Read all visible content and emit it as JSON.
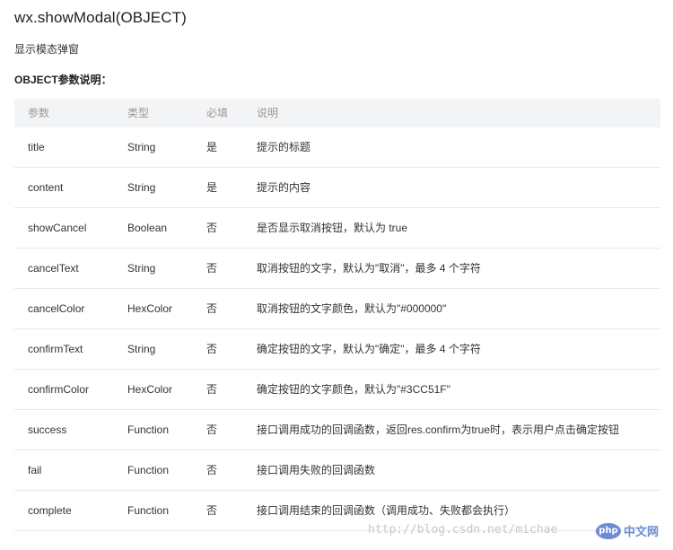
{
  "page": {
    "title": "wx.showModal(OBJECT)",
    "subtitle": "显示模态弹窗",
    "section_title": "OBJECT参数说明："
  },
  "table": {
    "headers": [
      "参数",
      "类型",
      "必填",
      "说明"
    ],
    "rows": [
      [
        "title",
        "String",
        "是",
        "提示的标题"
      ],
      [
        "content",
        "String",
        "是",
        "提示的内容"
      ],
      [
        "showCancel",
        "Boolean",
        "否",
        "是否显示取消按钮，默认为 true"
      ],
      [
        "cancelText",
        "String",
        "否",
        "取消按钮的文字，默认为\"取消\"，最多 4 个字符"
      ],
      [
        "cancelColor",
        "HexColor",
        "否",
        "取消按钮的文字颜色，默认为\"#000000\""
      ],
      [
        "confirmText",
        "String",
        "否",
        "确定按钮的文字，默认为\"确定\"，最多 4 个字符"
      ],
      [
        "confirmColor",
        "HexColor",
        "否",
        "确定按钮的文字颜色，默认为\"#3CC51F\""
      ],
      [
        "success",
        "Function",
        "否",
        "接口调用成功的回调函数，返回res.confirm为true时，表示用户点击确定按钮"
      ],
      [
        "fail",
        "Function",
        "否",
        "接口调用失败的回调函数"
      ],
      [
        "complete",
        "Function",
        "否",
        "接口调用结束的回调函数（调用成功、失败都会执行）"
      ]
    ]
  },
  "watermark": {
    "url_text": "http://blog.csdn.net/michae",
    "logo_badge": "php",
    "logo_text": "中文网"
  },
  "colors": {
    "header_bg": "#f3f4f6",
    "header_text": "#999999",
    "row_border": "#e9e9e9",
    "logo_blue": "#6c8cd5"
  }
}
